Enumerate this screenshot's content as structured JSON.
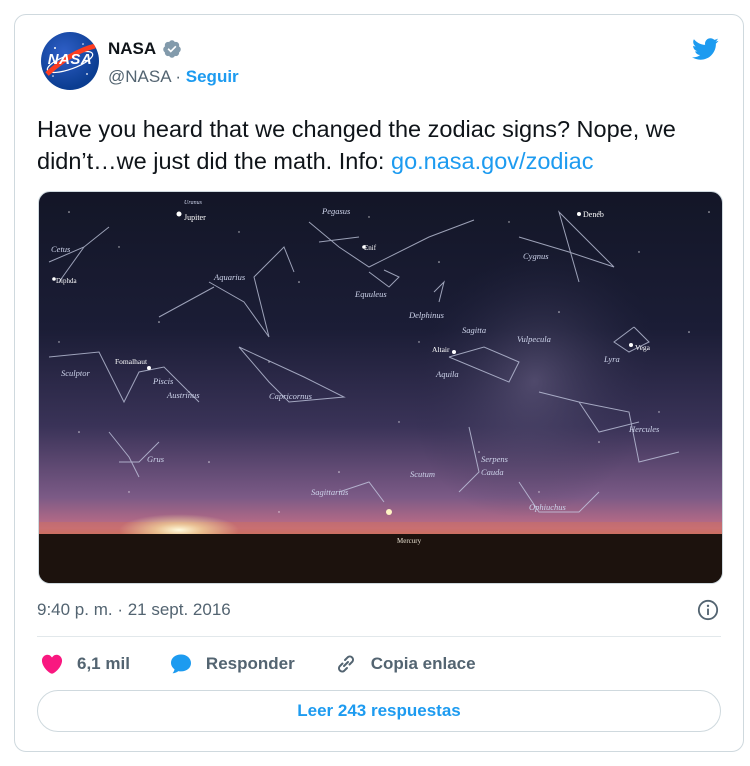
{
  "author": {
    "name": "NASA",
    "handle": "@NASA",
    "separator": "·",
    "follow_label": "Seguir",
    "avatar_text": "NASA",
    "verified": true
  },
  "tweet": {
    "text": "Have you heard that we changed the zodiac signs? Nope, we didn’t…we just did the math. Info: ",
    "link_text": "go.nasa.gov/zodiac",
    "timestamp": "9:40 p. m. · 21 sept. 2016"
  },
  "media": {
    "labels": {
      "uranus": "Uranus",
      "jupiter": "Jupiter",
      "pegasus": "Pegasus",
      "deneb": "Deneb",
      "cetus": "Cetus",
      "diphda": "Diphda",
      "enif": "Enif",
      "cygnus": "Cygnus",
      "aquarius": "Aquarius",
      "equuleus": "Equuleus",
      "delphinus": "Delphinus",
      "sagitta": "Sagitta",
      "vulpecula": "Vulpecula",
      "vega": "Vega",
      "lyra": "Lyra",
      "altair": "Altair",
      "aquila": "Aquila",
      "sculptor": "Sculptor",
      "fomalhaut": "Fomalhaut",
      "piscis": "Piscis",
      "austrinus": "Austrinus",
      "capricornus": "Capricornus",
      "hercules": "Hercules",
      "grus": "Grus",
      "serpens": "Serpens",
      "cauda": "Cauda",
      "scutum": "Scutum",
      "sagittarius": "Sagittarius",
      "ophiuchus": "Ophiuchus",
      "mercury": "Mercury"
    }
  },
  "actions": {
    "likes_count": "6,1 mil",
    "reply_label": "Responder",
    "copy_label": "Copia enlace"
  },
  "replies_button": "Leer 243 respuestas",
  "colors": {
    "accent": "#1d9bf0",
    "like": "#f91880",
    "text": "#0f1419",
    "muted": "#536471"
  },
  "icons": [
    "twitter-bird-icon",
    "verified-badge-icon",
    "info-icon",
    "heart-icon",
    "reply-bubble-icon",
    "link-icon"
  ]
}
